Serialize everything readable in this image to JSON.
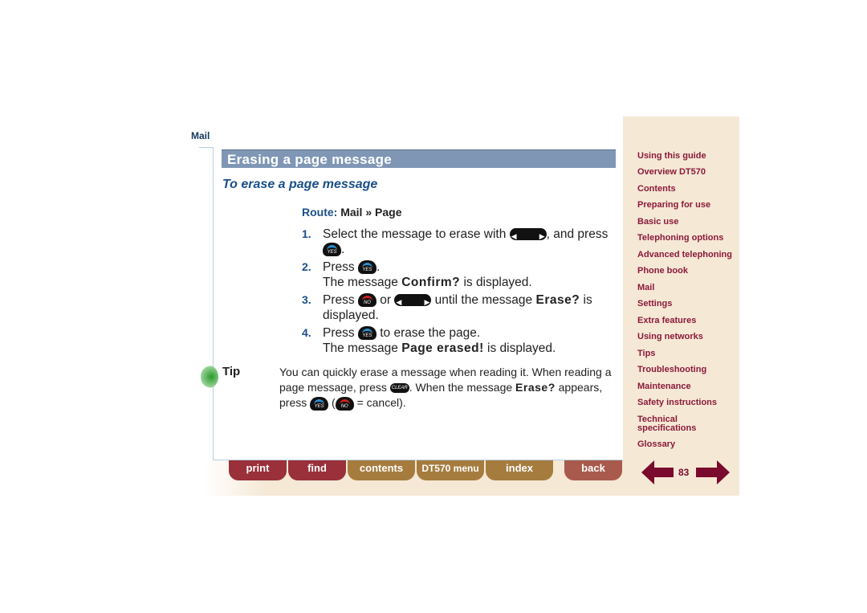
{
  "section": "Mail",
  "title": "Erasing a page message",
  "subtitle": "To erase a page message",
  "route": {
    "label": "Route:",
    "path": "Mail » Page"
  },
  "steps": [
    {
      "num": "1.",
      "a": "Select the message to erase with",
      "b": ", and press",
      "c": "."
    },
    {
      "num": "2.",
      "a": "Press",
      "b": ".",
      "line2a": "The message",
      "msg": "Confirm?",
      "line2b": "is displayed."
    },
    {
      "num": "3.",
      "a": "Press",
      "or": "or",
      "b": "until the message",
      "msg": "Erase?",
      "c": "is displayed."
    },
    {
      "num": "4.",
      "a": "Press",
      "b": "to erase the page.",
      "line2a": "The message",
      "msg": "Page erased!",
      "line2b": "is displayed."
    }
  ],
  "keys": {
    "yes": "YES",
    "no": "NO",
    "clear": "CLEAR"
  },
  "tip": {
    "label": "Tip",
    "a": "You can quickly erase a message when reading it. When reading a page message, press",
    "b": ". When the message",
    "msg": "Erase?",
    "c": "appears, press",
    "d": "(",
    "e": "= cancel)."
  },
  "sidebar": [
    "Using this guide",
    "Overview DT570",
    "Contents",
    "Preparing for use",
    "Basic use",
    "Telephoning options",
    "Advanced telephoning",
    "Phone book",
    "Mail",
    "Settings",
    "Extra features",
    "Using networks",
    "Tips",
    "Troubleshooting",
    "Maintenance",
    "Safety instructions",
    "Technical specifications",
    "Glossary"
  ],
  "bottom": {
    "print": "print",
    "find": "find",
    "contents": "contents",
    "menu": "DT570 menu",
    "index": "index",
    "back": "back",
    "page": "83"
  },
  "colors": {
    "title_bar": "#7f96b5",
    "heading": "#1a4f8a",
    "nav_link": "#8b1a3a",
    "sidebar_bg": "#f5e8d5",
    "button_red": "#9a3039",
    "button_gold": "#a67c3e"
  }
}
